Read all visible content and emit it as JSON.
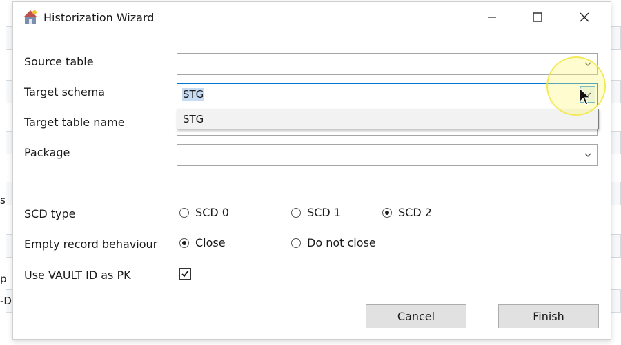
{
  "background": {
    "fragments": [
      "s",
      "p",
      "-D"
    ]
  },
  "window": {
    "title": "Historization Wizard",
    "controls": [
      "minimize",
      "maximize",
      "close"
    ]
  },
  "form": {
    "source_table": {
      "label": "Source table",
      "value": ""
    },
    "target_schema": {
      "label": "Target schema",
      "value": "STG",
      "dropdown_open": true,
      "options": [
        "STG"
      ]
    },
    "target_table_name": {
      "label": "Target table name",
      "value": ""
    },
    "package": {
      "label": "Package",
      "value": ""
    },
    "scd_type": {
      "label": "SCD type",
      "options": [
        {
          "label": "SCD 0",
          "selected": false
        },
        {
          "label": "SCD 1",
          "selected": false
        },
        {
          "label": "SCD 2",
          "selected": true
        }
      ]
    },
    "empty_record_behaviour": {
      "label": "Empty record behaviour",
      "options": [
        {
          "label": "Close",
          "selected": true
        },
        {
          "label": "Do not close",
          "selected": false
        }
      ]
    },
    "use_vault_id": {
      "label": "Use VAULT ID as PK",
      "checked": true
    }
  },
  "buttons": {
    "cancel": "Cancel",
    "finish": "Finish"
  },
  "colors": {
    "focus_border": "#0078d7",
    "selection": "#c7dcf2",
    "button_face": "#e1e1e1",
    "cursor_highlight": "#fffa78"
  }
}
